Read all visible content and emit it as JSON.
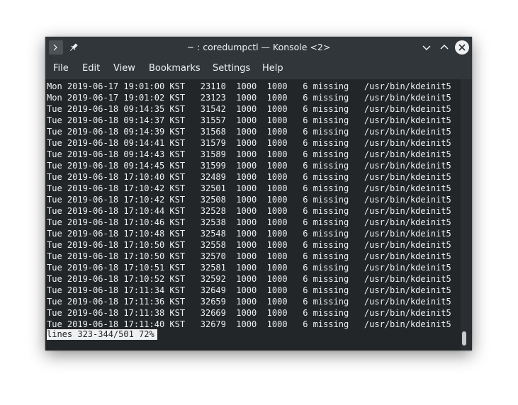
{
  "window": {
    "title": "~ : coredumpctl — Konsole <2>"
  },
  "menu": {
    "file": "File",
    "edit": "Edit",
    "view": "View",
    "bookmarks": "Bookmarks",
    "settings": "Settings",
    "help": "Help"
  },
  "terminal": {
    "lines": [
      "Mon 2019-06-17 19:01:00 KST   23110  1000  1000   6 missing   /usr/bin/kdeinit5",
      "Mon 2019-06-17 19:01:02 KST   23123  1000  1000   6 missing   /usr/bin/kdeinit5",
      "Tue 2019-06-18 09:14:35 KST   31542  1000  1000   6 missing   /usr/bin/kdeinit5",
      "Tue 2019-06-18 09:14:37 KST   31557  1000  1000   6 missing   /usr/bin/kdeinit5",
      "Tue 2019-06-18 09:14:39 KST   31568  1000  1000   6 missing   /usr/bin/kdeinit5",
      "Tue 2019-06-18 09:14:41 KST   31579  1000  1000   6 missing   /usr/bin/kdeinit5",
      "Tue 2019-06-18 09:14:43 KST   31589  1000  1000   6 missing   /usr/bin/kdeinit5",
      "Tue 2019-06-18 09:14:45 KST   31599  1000  1000   6 missing   /usr/bin/kdeinit5",
      "Tue 2019-06-18 17:10:40 KST   32489  1000  1000   6 missing   /usr/bin/kdeinit5",
      "Tue 2019-06-18 17:10:42 KST   32501  1000  1000   6 missing   /usr/bin/kdeinit5",
      "Tue 2019-06-18 17:10:42 KST   32508  1000  1000   6 missing   /usr/bin/kdeinit5",
      "Tue 2019-06-18 17:10:44 KST   32528  1000  1000   6 missing   /usr/bin/kdeinit5",
      "Tue 2019-06-18 17:10:46 KST   32538  1000  1000   6 missing   /usr/bin/kdeinit5",
      "Tue 2019-06-18 17:10:48 KST   32548  1000  1000   6 missing   /usr/bin/kdeinit5",
      "Tue 2019-06-18 17:10:50 KST   32558  1000  1000   6 missing   /usr/bin/kdeinit5",
      "Tue 2019-06-18 17:10:50 KST   32570  1000  1000   6 missing   /usr/bin/kdeinit5",
      "Tue 2019-06-18 17:10:51 KST   32581  1000  1000   6 missing   /usr/bin/kdeinit5",
      "Tue 2019-06-18 17:10:52 KST   32592  1000  1000   6 missing   /usr/bin/kdeinit5",
      "Tue 2019-06-18 17:11:34 KST   32649  1000  1000   6 missing   /usr/bin/kdeinit5",
      "Tue 2019-06-18 17:11:36 KST   32659  1000  1000   6 missing   /usr/bin/kdeinit5",
      "Tue 2019-06-18 17:11:38 KST   32669  1000  1000   6 missing   /usr/bin/kdeinit5",
      "Tue 2019-06-18 17:11:40 KST   32679  1000  1000   6 missing   /usr/bin/kdeinit5"
    ],
    "status": "lines 323-344/501 72%"
  },
  "icons": {
    "app": "konsole-icon",
    "pin": "pin-icon",
    "minimize": "chevron-down-icon",
    "maximize": "chevron-up-icon",
    "close": "close-icon"
  },
  "colors": {
    "titlebar": "#31363b",
    "terminal_bg": "#232629",
    "text": "#eff0f1"
  }
}
